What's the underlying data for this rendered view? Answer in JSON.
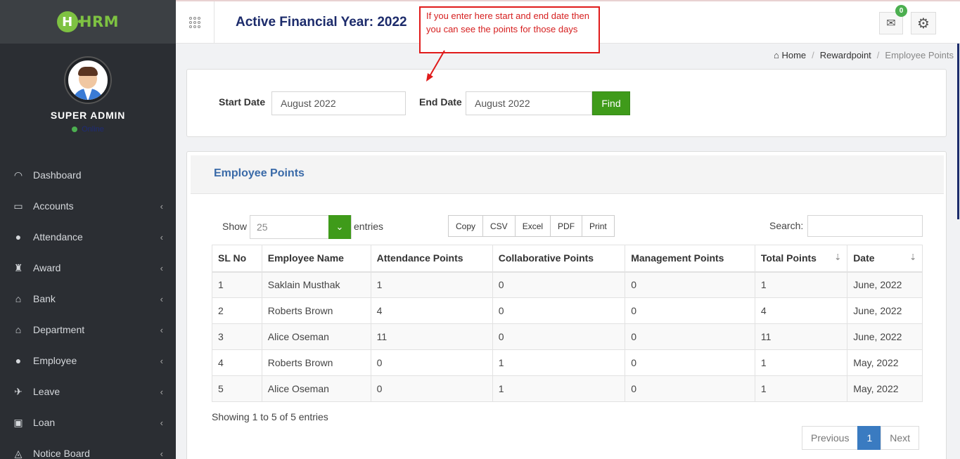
{
  "app": {
    "logo_text": "HRM",
    "logo_letter": "H"
  },
  "profile": {
    "name": "SUPER ADMIN",
    "status": "Online"
  },
  "sidebar": {
    "items": [
      {
        "label": "Dashboard",
        "icon": "dashboard-icon",
        "glyph": "◠"
      },
      {
        "label": "Accounts",
        "icon": "briefcase-icon",
        "glyph": "▭"
      },
      {
        "label": "Attendance",
        "icon": "user-icon",
        "glyph": "●"
      },
      {
        "label": "Award",
        "icon": "trophy-icon",
        "glyph": "♜"
      },
      {
        "label": "Bank",
        "icon": "bank-icon",
        "glyph": "⌂"
      },
      {
        "label": "Department",
        "icon": "building-icon",
        "glyph": "⌂"
      },
      {
        "label": "Employee",
        "icon": "users-icon",
        "glyph": "●"
      },
      {
        "label": "Leave",
        "icon": "plane-icon",
        "glyph": "✈"
      },
      {
        "label": "Loan",
        "icon": "money-icon",
        "glyph": "▣"
      },
      {
        "label": "Notice Board",
        "icon": "bell-icon",
        "glyph": "◬"
      }
    ],
    "chevron": "‹"
  },
  "header": {
    "financial_year": "Active Financial Year: 2022",
    "mail_count": "0"
  },
  "annotation": {
    "text": "If you enter here start and end date then you can see the points for those days"
  },
  "breadcrumb": {
    "home": "Home",
    "section": "Rewardpoint",
    "current": "Employee Points",
    "sep": "/"
  },
  "filter": {
    "start_label": "Start Date",
    "start_value": "August 2022",
    "end_label": "End Date",
    "end_value": "August 2022",
    "find_label": "Find"
  },
  "table_card": {
    "title": "Employee Points",
    "show_label": "Show",
    "length_value": "25",
    "entries_label": "entries",
    "buttons": [
      "Copy",
      "CSV",
      "Excel",
      "PDF",
      "Print"
    ],
    "search_label": "Search:",
    "columns": [
      "SL No",
      "Employee Name",
      "Attendance Points",
      "Collaborative Points",
      "Management Points",
      "Total Points",
      "Date"
    ],
    "rows": [
      [
        "1",
        "Saklain Musthak",
        "1",
        "0",
        "0",
        "1",
        "June, 2022"
      ],
      [
        "2",
        "Roberts Brown",
        "4",
        "0",
        "0",
        "4",
        "June, 2022"
      ],
      [
        "3",
        "Alice Oseman",
        "11",
        "0",
        "0",
        "11",
        "June, 2022"
      ],
      [
        "4",
        "Roberts Brown",
        "0",
        "1",
        "0",
        "1",
        "May, 2022"
      ],
      [
        "5",
        "Alice Oseman",
        "0",
        "1",
        "0",
        "1",
        "May, 2022"
      ]
    ],
    "info": "Showing 1 to 5 of 5 entries",
    "pager": {
      "prev": "Previous",
      "current": "1",
      "next": "Next"
    }
  },
  "colors": {
    "sidebar": "#2b2e33",
    "accent_green": "#3f9b1a",
    "title_blue": "#1c2b6b",
    "annotation_red": "#e01b1b"
  }
}
